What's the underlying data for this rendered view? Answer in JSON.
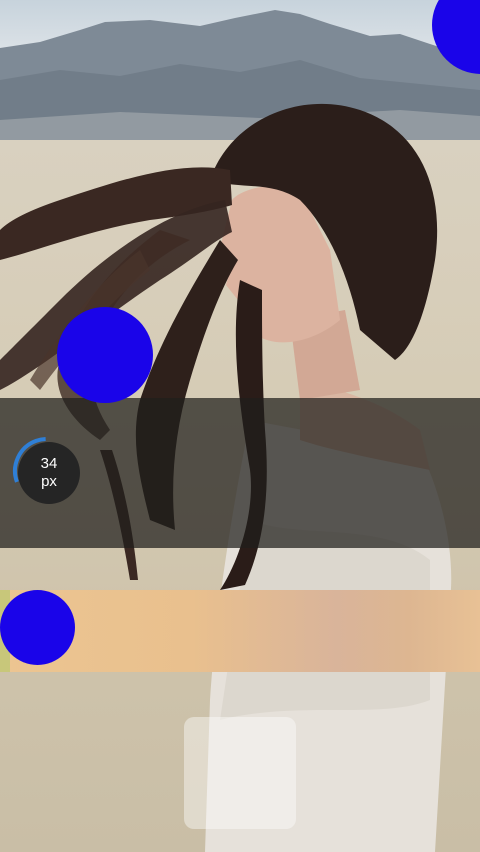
{
  "brush_size": {
    "value": "34",
    "unit": "px"
  },
  "colors": {
    "dot": "#1a04e9",
    "indicator_ring": "#2f7fd6",
    "dark_band": "#201e1c",
    "peach_band": "#ecc591"
  },
  "icons": [
    "brush-size-ring-icon"
  ]
}
